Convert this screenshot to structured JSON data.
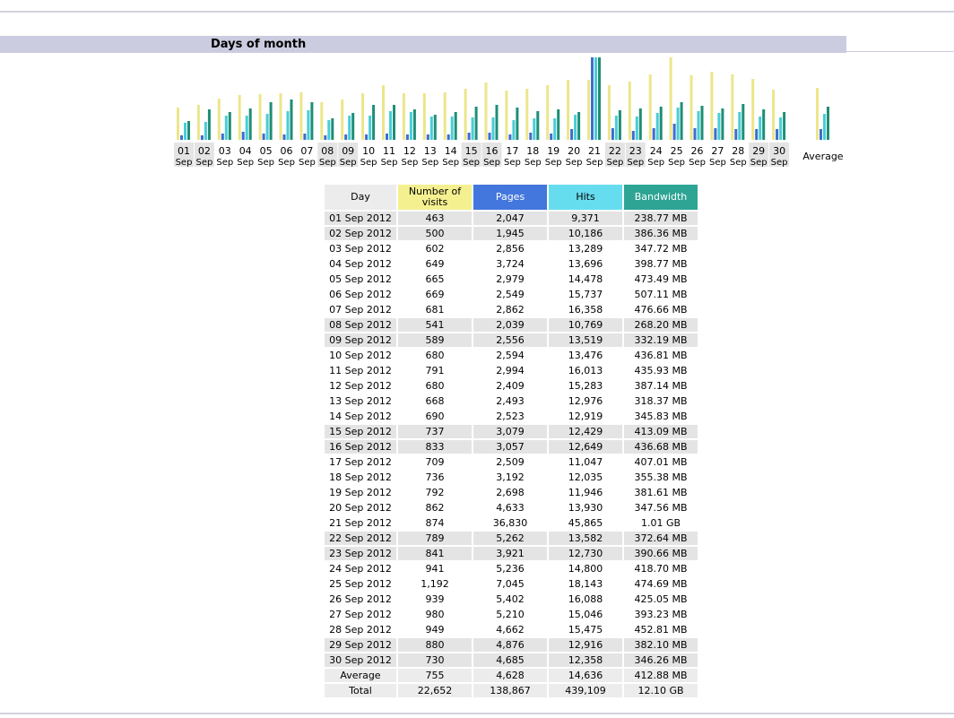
{
  "section": {
    "title": "Days of month"
  },
  "table": {
    "headers": {
      "day": "Day",
      "visits_line1": "Number of",
      "visits_line2": "visits",
      "pages": "Pages",
      "hits": "Hits",
      "bandwidth": "Bandwidth"
    },
    "rows": [
      {
        "day": "01 Sep 2012",
        "visits": "463",
        "pages": "2,047",
        "hits": "9,371",
        "bandwidth": "238.77 MB",
        "weekend": true
      },
      {
        "day": "02 Sep 2012",
        "visits": "500",
        "pages": "1,945",
        "hits": "10,186",
        "bandwidth": "386.36 MB",
        "weekend": true
      },
      {
        "day": "03 Sep 2012",
        "visits": "602",
        "pages": "2,856",
        "hits": "13,289",
        "bandwidth": "347.72 MB",
        "weekend": false
      },
      {
        "day": "04 Sep 2012",
        "visits": "649",
        "pages": "3,724",
        "hits": "13,696",
        "bandwidth": "398.77 MB",
        "weekend": false
      },
      {
        "day": "05 Sep 2012",
        "visits": "665",
        "pages": "2,979",
        "hits": "14,478",
        "bandwidth": "473.49 MB",
        "weekend": false
      },
      {
        "day": "06 Sep 2012",
        "visits": "669",
        "pages": "2,549",
        "hits": "15,737",
        "bandwidth": "507.11 MB",
        "weekend": false
      },
      {
        "day": "07 Sep 2012",
        "visits": "681",
        "pages": "2,862",
        "hits": "16,358",
        "bandwidth": "476.66 MB",
        "weekend": false
      },
      {
        "day": "08 Sep 2012",
        "visits": "541",
        "pages": "2,039",
        "hits": "10,769",
        "bandwidth": "268.20 MB",
        "weekend": true
      },
      {
        "day": "09 Sep 2012",
        "visits": "589",
        "pages": "2,556",
        "hits": "13,519",
        "bandwidth": "332.19 MB",
        "weekend": true
      },
      {
        "day": "10 Sep 2012",
        "visits": "680",
        "pages": "2,594",
        "hits": "13,476",
        "bandwidth": "436.81 MB",
        "weekend": false
      },
      {
        "day": "11 Sep 2012",
        "visits": "791",
        "pages": "2,994",
        "hits": "16,013",
        "bandwidth": "435.93 MB",
        "weekend": false
      },
      {
        "day": "12 Sep 2012",
        "visits": "680",
        "pages": "2,409",
        "hits": "15,283",
        "bandwidth": "387.14 MB",
        "weekend": false
      },
      {
        "day": "13 Sep 2012",
        "visits": "668",
        "pages": "2,493",
        "hits": "12,976",
        "bandwidth": "318.37 MB",
        "weekend": false
      },
      {
        "day": "14 Sep 2012",
        "visits": "690",
        "pages": "2,523",
        "hits": "12,919",
        "bandwidth": "345.83 MB",
        "weekend": false
      },
      {
        "day": "15 Sep 2012",
        "visits": "737",
        "pages": "3,079",
        "hits": "12,429",
        "bandwidth": "413.09 MB",
        "weekend": true
      },
      {
        "day": "16 Sep 2012",
        "visits": "833",
        "pages": "3,057",
        "hits": "12,649",
        "bandwidth": "436.68 MB",
        "weekend": true
      },
      {
        "day": "17 Sep 2012",
        "visits": "709",
        "pages": "2,509",
        "hits": "11,047",
        "bandwidth": "407.01 MB",
        "weekend": false
      },
      {
        "day": "18 Sep 2012",
        "visits": "736",
        "pages": "3,192",
        "hits": "12,035",
        "bandwidth": "355.38 MB",
        "weekend": false
      },
      {
        "day": "19 Sep 2012",
        "visits": "792",
        "pages": "2,698",
        "hits": "11,946",
        "bandwidth": "381.61 MB",
        "weekend": false
      },
      {
        "day": "20 Sep 2012",
        "visits": "862",
        "pages": "4,633",
        "hits": "13,930",
        "bandwidth": "347.56 MB",
        "weekend": false
      },
      {
        "day": "21 Sep 2012",
        "visits": "874",
        "pages": "36,830",
        "hits": "45,865",
        "bandwidth": "1.01 GB",
        "weekend": false
      },
      {
        "day": "22 Sep 2012",
        "visits": "789",
        "pages": "5,262",
        "hits": "13,582",
        "bandwidth": "372.64 MB",
        "weekend": true
      },
      {
        "day": "23 Sep 2012",
        "visits": "841",
        "pages": "3,921",
        "hits": "12,730",
        "bandwidth": "390.66 MB",
        "weekend": true
      },
      {
        "day": "24 Sep 2012",
        "visits": "941",
        "pages": "5,236",
        "hits": "14,800",
        "bandwidth": "418.70 MB",
        "weekend": false
      },
      {
        "day": "25 Sep 2012",
        "visits": "1,192",
        "pages": "7,045",
        "hits": "18,143",
        "bandwidth": "474.69 MB",
        "weekend": false
      },
      {
        "day": "26 Sep 2012",
        "visits": "939",
        "pages": "5,402",
        "hits": "16,088",
        "bandwidth": "425.05 MB",
        "weekend": false
      },
      {
        "day": "27 Sep 2012",
        "visits": "980",
        "pages": "5,210",
        "hits": "15,046",
        "bandwidth": "393.23 MB",
        "weekend": false
      },
      {
        "day": "28 Sep 2012",
        "visits": "949",
        "pages": "4,662",
        "hits": "15,475",
        "bandwidth": "452.81 MB",
        "weekend": false
      },
      {
        "day": "29 Sep 2012",
        "visits": "880",
        "pages": "4,876",
        "hits": "12,916",
        "bandwidth": "382.10 MB",
        "weekend": true
      },
      {
        "day": "30 Sep 2012",
        "visits": "730",
        "pages": "4,685",
        "hits": "12,358",
        "bandwidth": "346.26 MB",
        "weekend": true
      }
    ],
    "average": {
      "day": "Average",
      "visits": "755",
      "pages": "4,628",
      "hits": "14,636",
      "bandwidth": "412.88 MB"
    },
    "total": {
      "day": "Total",
      "visits": "22,652",
      "pages": "138,867",
      "hits": "439,109",
      "bandwidth": "12.10 GB"
    }
  },
  "chart_data": {
    "type": "bar",
    "title": "",
    "xlabel": "",
    "ylabel": "",
    "grid": false,
    "categories": [
      "01",
      "02",
      "03",
      "04",
      "05",
      "06",
      "07",
      "08",
      "09",
      "10",
      "11",
      "12",
      "13",
      "14",
      "15",
      "16",
      "17",
      "18",
      "19",
      "20",
      "21",
      "22",
      "23",
      "24",
      "25",
      "26",
      "27",
      "28",
      "29",
      "30"
    ],
    "month_label": "Sep",
    "weekend_days": [
      "01",
      "02",
      "08",
      "09",
      "15",
      "16",
      "22",
      "23",
      "29",
      "30"
    ],
    "average_label": "Average",
    "series": [
      {
        "values": [
          463,
          500,
          602,
          649,
          665,
          669,
          681,
          541,
          589,
          680,
          791,
          680,
          668,
          690,
          737,
          833,
          709,
          736,
          792,
          862,
          874,
          789,
          841,
          941,
          1192,
          939,
          980,
          949,
          880,
          730
        ],
        "average": 755,
        "color": "#ece68a"
      },
      {
        "values": [
          2047,
          1945,
          2856,
          3724,
          2979,
          2549,
          2862,
          2039,
          2556,
          2594,
          2994,
          2409,
          2493,
          2523,
          3079,
          3057,
          2509,
          3192,
          2698,
          4633,
          36830,
          5262,
          3921,
          5236,
          7045,
          5402,
          5210,
          4662,
          4876,
          4685
        ],
        "average": 4628,
        "color": "#3f6ccf"
      },
      {
        "values": [
          9371,
          10186,
          13289,
          13696,
          14478,
          15737,
          16358,
          10769,
          13519,
          13476,
          16013,
          15283,
          12976,
          12919,
          12429,
          12649,
          11047,
          12035,
          11946,
          13930,
          45865,
          13582,
          12730,
          14800,
          18143,
          16088,
          15046,
          15475,
          12916,
          12358
        ],
        "average": 14636,
        "color": "#48cdd6"
      },
      {
        "values": [
          238.77,
          386.36,
          347.72,
          398.77,
          473.49,
          507.11,
          476.66,
          268.2,
          332.19,
          436.81,
          435.93,
          387.14,
          318.37,
          345.83,
          413.09,
          436.68,
          407.01,
          355.38,
          381.61,
          347.56,
          1034.24,
          372.64,
          390.66,
          418.7,
          474.69,
          425.05,
          393.23,
          452.81,
          382.1,
          346.26
        ],
        "average": 412.88,
        "unit": "MB",
        "color": "#1e8e76"
      }
    ]
  }
}
